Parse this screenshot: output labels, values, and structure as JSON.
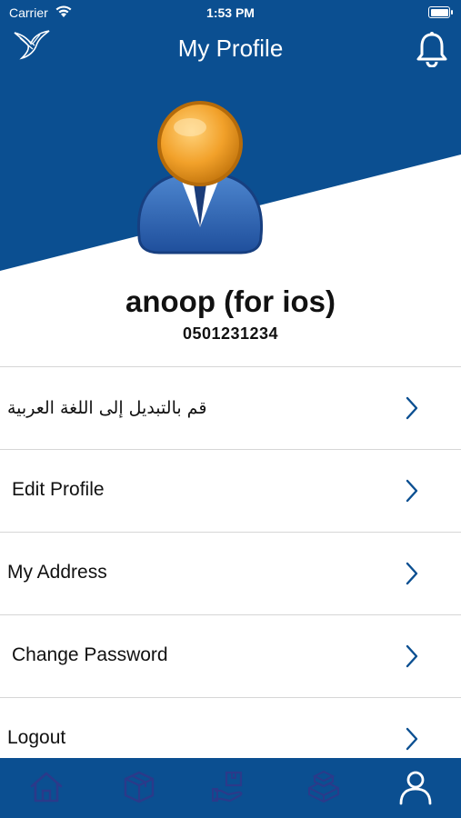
{
  "status_bar": {
    "carrier": "Carrier",
    "time": "1:53 PM",
    "battery_level": 1.0
  },
  "nav": {
    "title": "My Profile",
    "logo_icon": "bird-logo-icon",
    "right_icon": "bell-icon"
  },
  "profile": {
    "name": "anoop (for ios)",
    "phone": "0501231234",
    "avatar_icon": "user-avatar-icon"
  },
  "menu": {
    "items": [
      {
        "label": "قم بالتبديل إلى اللغة العربية",
        "icon": "chevron-right-icon"
      },
      {
        "label": "Edit Profile",
        "icon": "chevron-right-icon"
      },
      {
        "label": "My Address",
        "icon": "chevron-right-icon"
      },
      {
        "label": "Change Password",
        "icon": "chevron-right-icon"
      },
      {
        "label": "Logout",
        "icon": "chevron-right-icon"
      }
    ]
  },
  "tab_bar": {
    "tabs": [
      {
        "icon": "home-icon",
        "active": false
      },
      {
        "icon": "box-icon",
        "active": false
      },
      {
        "icon": "hand-box-icon",
        "active": false
      },
      {
        "icon": "stacked-boxes-icon",
        "active": false
      },
      {
        "icon": "profile-icon",
        "active": true
      }
    ]
  },
  "colors": {
    "primary": "#0b4f91",
    "tab_inactive": "#2b3a8a",
    "tab_active": "#ffffff",
    "chevron": "#0b4f91"
  }
}
